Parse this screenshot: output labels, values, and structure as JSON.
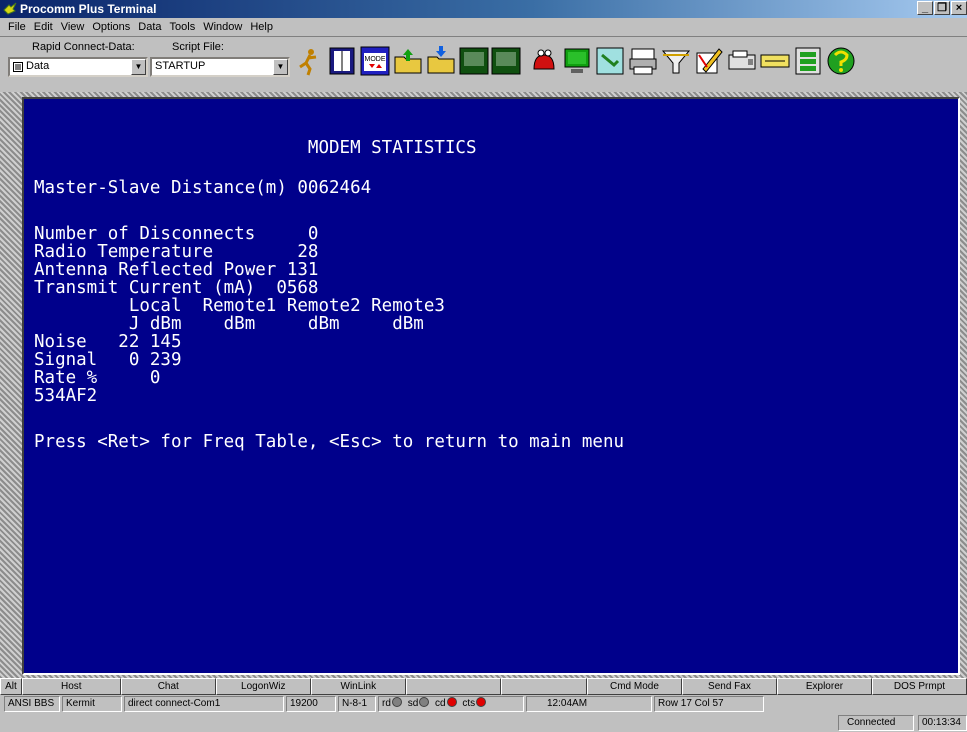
{
  "window": {
    "title": "Procomm Plus Terminal",
    "controls": [
      "_",
      "❐",
      "×"
    ]
  },
  "menu": [
    "File",
    "Edit",
    "View",
    "Options",
    "Data",
    "Tools",
    "Window",
    "Help"
  ],
  "toolbar": {
    "rapid_connect_label": "Rapid Connect-Data:",
    "rapid_connect_value": "Data",
    "script_file_label": "Script File:",
    "script_file_value": "STARTUP",
    "mode_icon_text": "MODE"
  },
  "terminal": {
    "lines": [
      "                          MODEM STATISTICS",
      "Master-Slave Distance(m) 0062464",
      "Number of Disconnects     0",
      "Radio Temperature        28",
      "Antenna Reflected Power 131",
      "Transmit Current (mA)  0568",
      "         Local  Remote1 Remote2 Remote3",
      "         J dBm    dBm     dBm     dBm",
      "Noise   22 145",
      "Signal   0 239",
      "Rate %     0",
      "534AF2",
      "Press <Ret> for Freq Table, <Esc> to return to main menu"
    ]
  },
  "buttonbar": [
    "Alt",
    "Host",
    "Chat",
    "LogonWiz",
    "WinLink",
    "",
    "",
    "Cmd Mode",
    "Send Fax",
    "Explorer",
    "DOS Prmpt"
  ],
  "statusbar": {
    "emulation": "ANSI BBS",
    "protocol": "Kermit",
    "connection": "direct connect-Com1",
    "baud": "19200",
    "parity": "N-8-1",
    "leds": [
      {
        "label": "rd",
        "color": "#808080"
      },
      {
        "label": "sd",
        "color": "#808080"
      },
      {
        "label": "cd",
        "color": "#e00000"
      },
      {
        "label": "cts",
        "color": "#e00000"
      }
    ],
    "time": "12:04AM",
    "cursor": "Row 17  Col 57"
  },
  "bottom": {
    "status": "Connected",
    "elapsed": "00:13:34"
  },
  "colors": {
    "terminal_bg": "#00008b",
    "terminal_fg": "#ffffff",
    "titlebar": "#0a246a"
  }
}
